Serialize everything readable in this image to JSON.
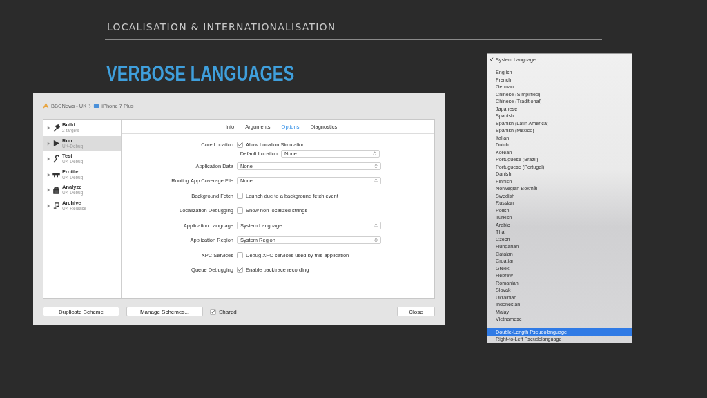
{
  "slide": {
    "section": "LOCALISATION & INTERNATIONALISATION",
    "title": "VERBOSE LANGUAGES"
  },
  "dialog": {
    "breadcrumb": [
      "BBCNews - UK",
      "iPhone 7 Plus"
    ],
    "sidebar": [
      {
        "name": "Build",
        "sub": "2 targets",
        "selected": false
      },
      {
        "name": "Run",
        "sub": "UK-Debug",
        "selected": true
      },
      {
        "name": "Test",
        "sub": "UK-Debug",
        "selected": false
      },
      {
        "name": "Profile",
        "sub": "UK-Debug",
        "selected": false
      },
      {
        "name": "Analyze",
        "sub": "UK-Debug",
        "selected": false
      },
      {
        "name": "Archive",
        "sub": "UK-Release",
        "selected": false
      }
    ],
    "tabs": [
      {
        "label": "Info",
        "selected": false
      },
      {
        "label": "Arguments",
        "selected": false
      },
      {
        "label": "Options",
        "selected": true
      },
      {
        "label": "Diagnostics",
        "selected": false
      }
    ],
    "rows": [
      {
        "label": "Core Location",
        "kind": "checkbox",
        "checked": true,
        "text": "Allow Location Simulation",
        "sub": {
          "label": "Default Location",
          "value": "None"
        }
      },
      {
        "label": "Application Data",
        "kind": "popup",
        "value": "None"
      },
      {
        "label": "Routing App Coverage File",
        "kind": "popup",
        "value": "None"
      },
      {
        "label": "Background Fetch",
        "kind": "checkbox",
        "checked": false,
        "text": "Launch due to a background fetch event"
      },
      {
        "label": "Localization Debugging",
        "kind": "checkbox",
        "checked": false,
        "text": "Show non-localized strings"
      },
      {
        "label": "Application Language",
        "kind": "popup",
        "value": "System Language"
      },
      {
        "label": "Application Region",
        "kind": "popup",
        "value": "System Region"
      },
      {
        "label": "XPC Services",
        "kind": "checkbox",
        "checked": false,
        "text": "Debug XPC services used by this application"
      },
      {
        "label": "Queue Debugging",
        "kind": "checkbox",
        "checked": true,
        "text": "Enable backtrace recording"
      }
    ],
    "buttons": [
      "Duplicate Scheme",
      "Manage Schemes..."
    ],
    "shared": {
      "label": "Shared",
      "checked": true
    },
    "close": "Close"
  },
  "menu": {
    "sections": [
      [
        {
          "label": "System Language",
          "checked": true,
          "selected": false
        }
      ],
      [
        {
          "label": "English",
          "checked": false,
          "selected": false
        },
        {
          "label": "French",
          "checked": false,
          "selected": false
        },
        {
          "label": "German",
          "checked": false,
          "selected": false
        },
        {
          "label": "Chinese (Simplified)",
          "checked": false,
          "selected": false
        },
        {
          "label": "Chinese (Traditional)",
          "checked": false,
          "selected": false
        },
        {
          "label": "Japanese",
          "checked": false,
          "selected": false
        },
        {
          "label": "Spanish",
          "checked": false,
          "selected": false
        },
        {
          "label": "Spanish (Latin America)",
          "checked": false,
          "selected": false
        },
        {
          "label": "Spanish (Mexico)",
          "checked": false,
          "selected": false
        },
        {
          "label": "Italian",
          "checked": false,
          "selected": false
        },
        {
          "label": "Dutch",
          "checked": false,
          "selected": false
        },
        {
          "label": "Korean",
          "checked": false,
          "selected": false
        },
        {
          "label": "Portuguese (Brazil)",
          "checked": false,
          "selected": false
        },
        {
          "label": "Portuguese (Portugal)",
          "checked": false,
          "selected": false
        },
        {
          "label": "Danish",
          "checked": false,
          "selected": false
        },
        {
          "label": "Finnish",
          "checked": false,
          "selected": false
        },
        {
          "label": "Norwegian Bokmål",
          "checked": false,
          "selected": false
        },
        {
          "label": "Swedish",
          "checked": false,
          "selected": false
        },
        {
          "label": "Russian",
          "checked": false,
          "selected": false
        },
        {
          "label": "Polish",
          "checked": false,
          "selected": false
        },
        {
          "label": "Turkish",
          "checked": false,
          "selected": false
        },
        {
          "label": "Arabic",
          "checked": false,
          "selected": false
        },
        {
          "label": "Thai",
          "checked": false,
          "selected": false
        },
        {
          "label": "Czech",
          "checked": false,
          "selected": false
        },
        {
          "label": "Hungarian",
          "checked": false,
          "selected": false
        },
        {
          "label": "Catalan",
          "checked": false,
          "selected": false
        },
        {
          "label": "Croatian",
          "checked": false,
          "selected": false
        },
        {
          "label": "Greek",
          "checked": false,
          "selected": false
        },
        {
          "label": "Hebrew",
          "checked": false,
          "selected": false
        },
        {
          "label": "Romanian",
          "checked": false,
          "selected": false
        },
        {
          "label": "Slovak",
          "checked": false,
          "selected": false
        },
        {
          "label": "Ukrainian",
          "checked": false,
          "selected": false
        },
        {
          "label": "Indonesian",
          "checked": false,
          "selected": false
        },
        {
          "label": "Malay",
          "checked": false,
          "selected": false
        },
        {
          "label": "Vietnamese",
          "checked": false,
          "selected": false
        }
      ],
      [
        {
          "label": "Double-Length Pseudolanguage",
          "checked": false,
          "selected": true
        },
        {
          "label": "Right-to-Left Pseudolanguage",
          "checked": false,
          "selected": false
        }
      ]
    ]
  }
}
